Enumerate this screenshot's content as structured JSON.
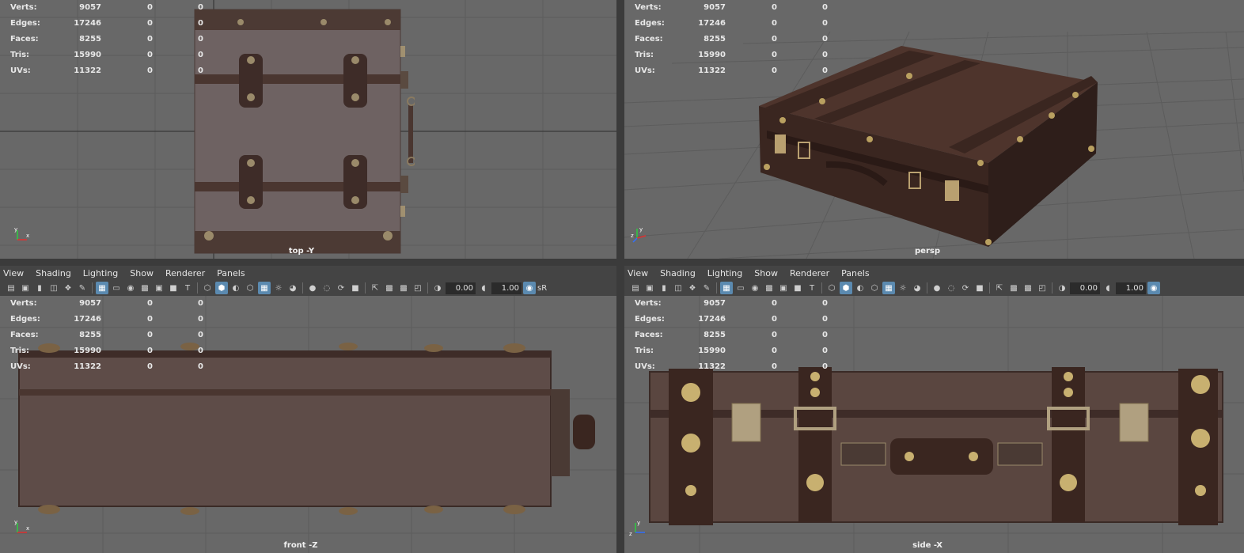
{
  "stats_labels": {
    "verts": "Verts:",
    "edges": "Edges:",
    "faces": "Faces:",
    "tris": "Tris:",
    "uvs": "UVs:"
  },
  "stats_values": {
    "verts": [
      "9057",
      "0",
      "0"
    ],
    "edges": [
      "17246",
      "0",
      "0"
    ],
    "faces": [
      "8255",
      "0",
      "0"
    ],
    "tris": [
      "15990",
      "0",
      "0"
    ],
    "uvs": [
      "11322",
      "0",
      "0"
    ]
  },
  "viewports": {
    "top": {
      "camera": "top -Y"
    },
    "persp": {
      "camera": "persp"
    },
    "front": {
      "camera": "front -Z"
    },
    "side": {
      "camera": "side -X"
    }
  },
  "menu": {
    "view": "View",
    "shading": "Shading",
    "lighting": "Lighting",
    "show": "Show",
    "renderer": "Renderer",
    "panels": "Panels"
  },
  "toolbar": {
    "exposure": "0.00",
    "gamma": "1.00",
    "colorspace": "sR"
  },
  "colors": {
    "viewport_bg": "#686868",
    "grid_line": "#5a5a5a",
    "grid_axis": "#3f3f3f",
    "leather_dark": "#3a2620",
    "leather_mid": "#5a4038",
    "brass": "#b9a060",
    "panel_bg": "#444444",
    "accent_blue": "#5b8ab0"
  },
  "axes": {
    "x": "x",
    "y": "y",
    "z": "z"
  }
}
